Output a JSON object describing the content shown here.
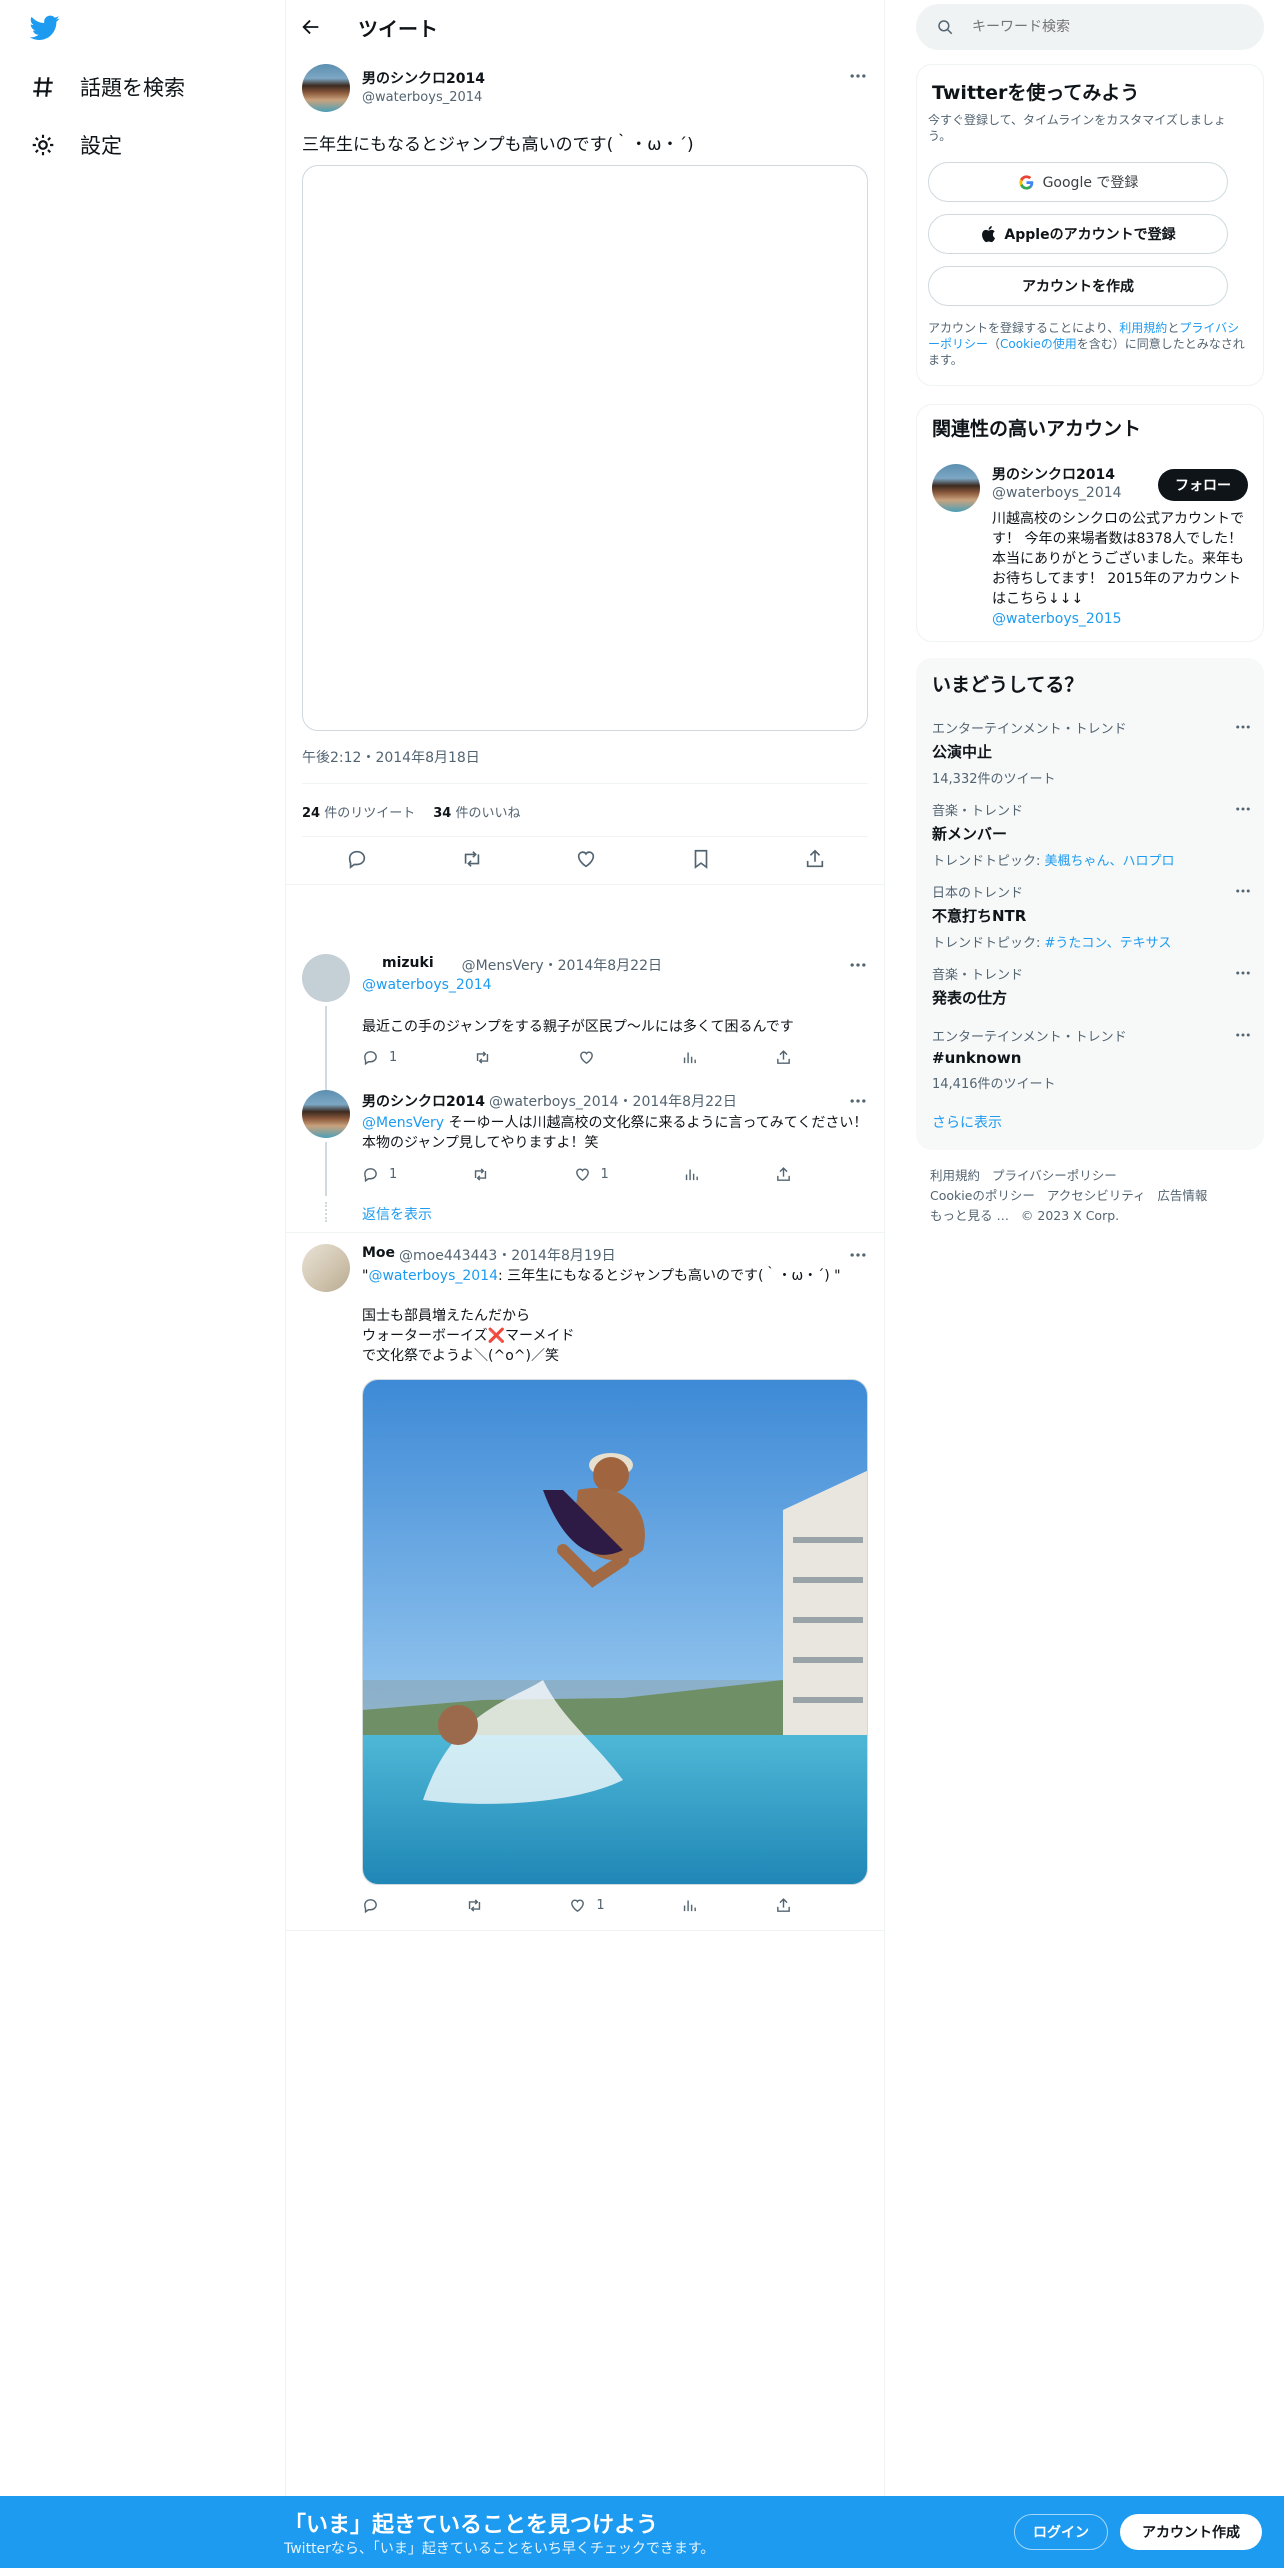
{
  "nav": {
    "explore": "話題を検索",
    "settings": "設定"
  },
  "header": {
    "title": "ツイート"
  },
  "tweet": {
    "name": "男のシンクロ2014",
    "handle": "@waterboys_2014",
    "text": "三年生にもなるとジャンプも高いのです(｀・ω・´)",
    "timestamp": "午後2:12・2014年8月18日",
    "retweets": "24",
    "retweets_label": "件のリツイート",
    "likes": "34",
    "likes_label": "件のいいね"
  },
  "replies": [
    {
      "name": "mizuki",
      "handle": "@MensVery",
      "date": "・2014年8月22日",
      "reply_to": "@waterboys_2014",
      "text": "最近この手のジャンプをする親子が区民プ～ルには多くて困るんです",
      "reply_count": "1",
      "retweet_count": "",
      "like_count": ""
    },
    {
      "name": "男のシンクロ2014",
      "handle": "@waterboys_2014",
      "date": "・2014年8月22日",
      "mention": "@MensVery",
      "text": "そーゆー人は川越高校の文化祭に来るように言ってみてください！本物のジャンプ見してやりますよ！笑",
      "reply_count": "1",
      "retweet_count": "",
      "like_count": "1"
    }
  ],
  "show_replies": "返信を表示",
  "quote": {
    "name": "Moe",
    "handle": "@moe443443",
    "date": "・2014年8月19日",
    "quote_open": "\"",
    "quote_mention": "@waterboys_2014",
    "quote_text": ": 三年生にもなるとジャンプも高いのです(｀・ω・´)",
    "quote_close": " \"",
    "line1": "国士も部員増えたんだから",
    "line2": "ウォーターボーイズ❌マーメイド",
    "line3": "で文化祭でようよ＼(^o^)／笑",
    "reply_count": "",
    "retweet_count": "",
    "like_count": "1"
  },
  "search": {
    "placeholder": "キーワード検索"
  },
  "signup": {
    "title": "Twitterを使ってみよう",
    "subtitle": "今すぐ登録して、タイムラインをカスタマイズしましょう。",
    "google": "Google で登録",
    "apple": "Appleのアカウントで登録",
    "create": "アカウントを作成",
    "legal_1": "アカウントを登録することにより、",
    "legal_terms": "利用規約",
    "legal_2": "と",
    "legal_privacy": "プライバシーポリシー",
    "legal_3": "（",
    "legal_cookie": "Cookieの使用",
    "legal_4": "を含む）に同意したとみなされます。"
  },
  "related": {
    "title": "関連性の高いアカウント",
    "name": "男のシンクロ2014",
    "handle": "@waterboys_2014",
    "follow": "フォロー",
    "bio": "川越高校のシンクロの公式アカウントです！ 今年の来場者数は8378人でした！本当にありがとうございました。来年もお待ちしてます！ 2015年のアカウントはこちら↓↓↓",
    "bio_link": "@waterboys_2015"
  },
  "trends": {
    "title": "いまどうしてる？",
    "items": [
      {
        "category": "エンターテインメント・トレンド",
        "name": "公演中止",
        "sub": "14,332件のツイート",
        "sub_links": ""
      },
      {
        "category": "音楽・トレンド",
        "name": "新メンバー",
        "sub": "トレンドトピック: ",
        "sub_links": "美楓ちゃん、ハロプロ"
      },
      {
        "category": "日本のトレンド",
        "name": "不意打ちNTR",
        "sub": "トレンドトピック: ",
        "sub_links": "#うたコン、テキサス"
      },
      {
        "category": "音楽・トレンド",
        "name": "発表の仕方",
        "sub": "",
        "sub_links": ""
      },
      {
        "category": "エンターテインメント・トレンド",
        "name": "#unknown",
        "sub": "14,416件のツイート",
        "sub_links": ""
      }
    ],
    "show_more": "さらに表示"
  },
  "footer": {
    "terms": "利用規約",
    "privacy": "プライバシーポリシー",
    "cookie": "Cookieのポリシー",
    "accessibility": "アクセシビリティ",
    "ads": "広告情報",
    "more": "もっと見る …",
    "copyright": "© 2023 X Corp."
  },
  "banner": {
    "title": "「いま」起きていることを見つけよう",
    "subtitle": "Twitterなら、「いま」起きていることをいち早くチェックできます。",
    "login": "ログイン",
    "signup": "アカウント作成"
  },
  "colors": {
    "accent": "#1d9bf0",
    "text": "#0f1419",
    "muted": "#536471",
    "border": "#eff3f4"
  }
}
